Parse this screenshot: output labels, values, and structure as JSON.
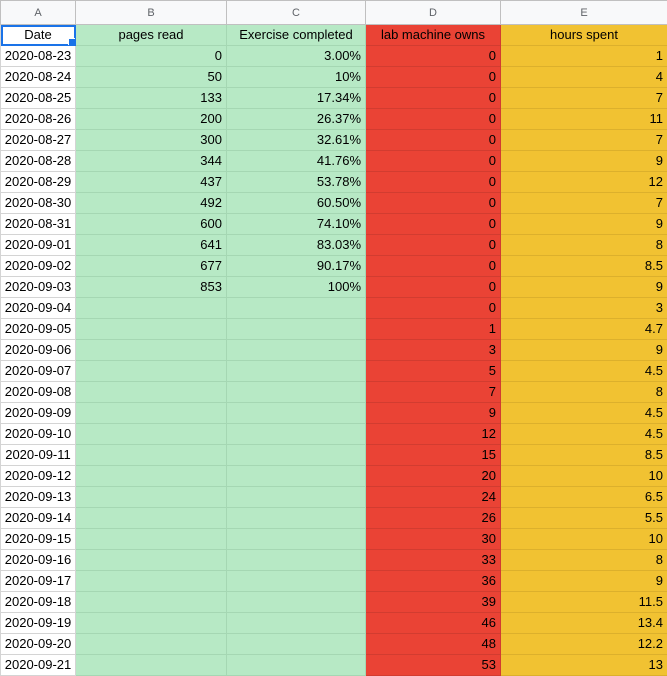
{
  "columns": [
    "A",
    "B",
    "C",
    "D",
    "E"
  ],
  "headers": [
    "Date",
    "pages read",
    "Exercise completed",
    "lab machine owns",
    "hours spent"
  ],
  "colors": {
    "green": "#b7e9c5",
    "red": "#ea4335",
    "yellow": "#f1c232",
    "selection": "#1a73e8"
  },
  "rows": [
    [
      "2020-08-23",
      "0",
      "3.00%",
      "0",
      "1"
    ],
    [
      "2020-08-24",
      "50",
      "10%",
      "0",
      "4"
    ],
    [
      "2020-08-25",
      "133",
      "17.34%",
      "0",
      "7"
    ],
    [
      "2020-08-26",
      "200",
      "26.37%",
      "0",
      "11"
    ],
    [
      "2020-08-27",
      "300",
      "32.61%",
      "0",
      "7"
    ],
    [
      "2020-08-28",
      "344",
      "41.76%",
      "0",
      "9"
    ],
    [
      "2020-08-29",
      "437",
      "53.78%",
      "0",
      "12"
    ],
    [
      "2020-08-30",
      "492",
      "60.50%",
      "0",
      "7"
    ],
    [
      "2020-08-31",
      "600",
      "74.10%",
      "0",
      "9"
    ],
    [
      "2020-09-01",
      "641",
      "83.03%",
      "0",
      "8"
    ],
    [
      "2020-09-02",
      "677",
      "90.17%",
      "0",
      "8.5"
    ],
    [
      "2020-09-03",
      "853",
      "100%",
      "0",
      "9"
    ],
    [
      "2020-09-04",
      "",
      "",
      "0",
      "3"
    ],
    [
      "2020-09-05",
      "",
      "",
      "1",
      "4.7"
    ],
    [
      "2020-09-06",
      "",
      "",
      "3",
      "9"
    ],
    [
      "2020-09-07",
      "",
      "",
      "5",
      "4.5"
    ],
    [
      "2020-09-08",
      "",
      "",
      "7",
      "8"
    ],
    [
      "2020-09-09",
      "",
      "",
      "9",
      "4.5"
    ],
    [
      "2020-09-10",
      "",
      "",
      "12",
      "4.5"
    ],
    [
      "2020-09-11",
      "",
      "",
      "15",
      "8.5"
    ],
    [
      "2020-09-12",
      "",
      "",
      "20",
      "10"
    ],
    [
      "2020-09-13",
      "",
      "",
      "24",
      "6.5"
    ],
    [
      "2020-09-14",
      "",
      "",
      "26",
      "5.5"
    ],
    [
      "2020-09-15",
      "",
      "",
      "30",
      "10"
    ],
    [
      "2020-09-16",
      "",
      "",
      "33",
      "8"
    ],
    [
      "2020-09-17",
      "",
      "",
      "36",
      "9"
    ],
    [
      "2020-09-18",
      "",
      "",
      "39",
      "11.5"
    ],
    [
      "2020-09-19",
      "",
      "",
      "46",
      "13.4"
    ],
    [
      "2020-09-20",
      "",
      "",
      "48",
      "12.2"
    ],
    [
      "2020-09-21",
      "",
      "",
      "53",
      "13"
    ]
  ]
}
